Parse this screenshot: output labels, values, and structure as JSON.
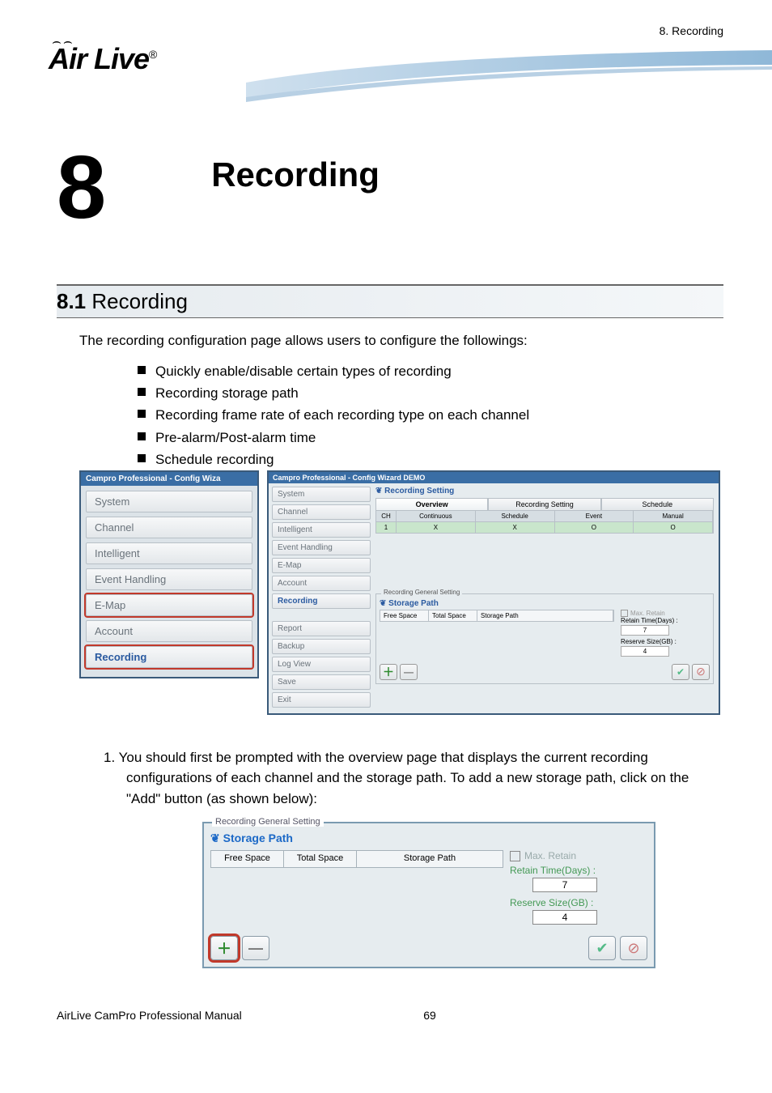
{
  "header": {
    "breadcrumb": "8. Recording",
    "logo_text": "Air Live",
    "logo_reg": "®"
  },
  "chapter": {
    "number": "8",
    "title": "Recording"
  },
  "section": {
    "number": "8.1",
    "title": "Recording"
  },
  "intro": "The recording configuration page allows users to configure the followings:",
  "bullets": [
    "Quickly enable/disable certain types of recording",
    "Recording storage path",
    "Recording frame rate of each recording type on each channel",
    "Pre-alarm/Post-alarm time",
    "Schedule recording"
  ],
  "mini_sidebar": {
    "title": "Campro Professional - Config Wiza",
    "items": [
      "System",
      "Channel",
      "Intelligent",
      "Event Handling",
      "E-Map",
      "Account",
      "Recording"
    ]
  },
  "config": {
    "title": "Campro Professional - Config Wizard DEMO",
    "nav": [
      "System",
      "Channel",
      "Intelligent",
      "Event Handling",
      "E-Map",
      "Account",
      "Recording",
      "Report",
      "Backup",
      "Log View",
      "Save",
      "Exit"
    ],
    "rec_heading": "Recording Setting",
    "tabs": [
      "Overview",
      "Recording Setting",
      "Schedule"
    ],
    "cols": [
      "CH",
      "Continuous",
      "Schedule",
      "Event",
      "Manual"
    ],
    "row": [
      "1",
      "X",
      "X",
      "O",
      "O"
    ],
    "gen_legend": "Recording General Setting",
    "sp_head": "Storage Path",
    "sp_cols": [
      "Free Space",
      "Total Space",
      "Storage Path"
    ],
    "max_retain": "Max. Retain",
    "retain_days": "Retain Time(Days) :",
    "retain_days_val": "7",
    "reserve": "Reserve Size(GB) :",
    "reserve_val": "4"
  },
  "para1": "1.  You should first be prompted with the overview page that displays the current recording configurations of each channel and the storage path. To add a new storage path, click on the \"Add\" button (as shown below):",
  "sp_detail": {
    "legend": "Recording General Setting",
    "title": "Storage Path",
    "cols": [
      "Free Space",
      "Total Space",
      "Storage Path"
    ],
    "max_retain": "Max. Retain",
    "retain_days": "Retain Time(Days) :",
    "retain_days_val": "7",
    "reserve": "Reserve Size(GB) :",
    "reserve_val": "4"
  },
  "footer": {
    "left": "AirLive CamPro Professional Manual",
    "page": "69"
  }
}
